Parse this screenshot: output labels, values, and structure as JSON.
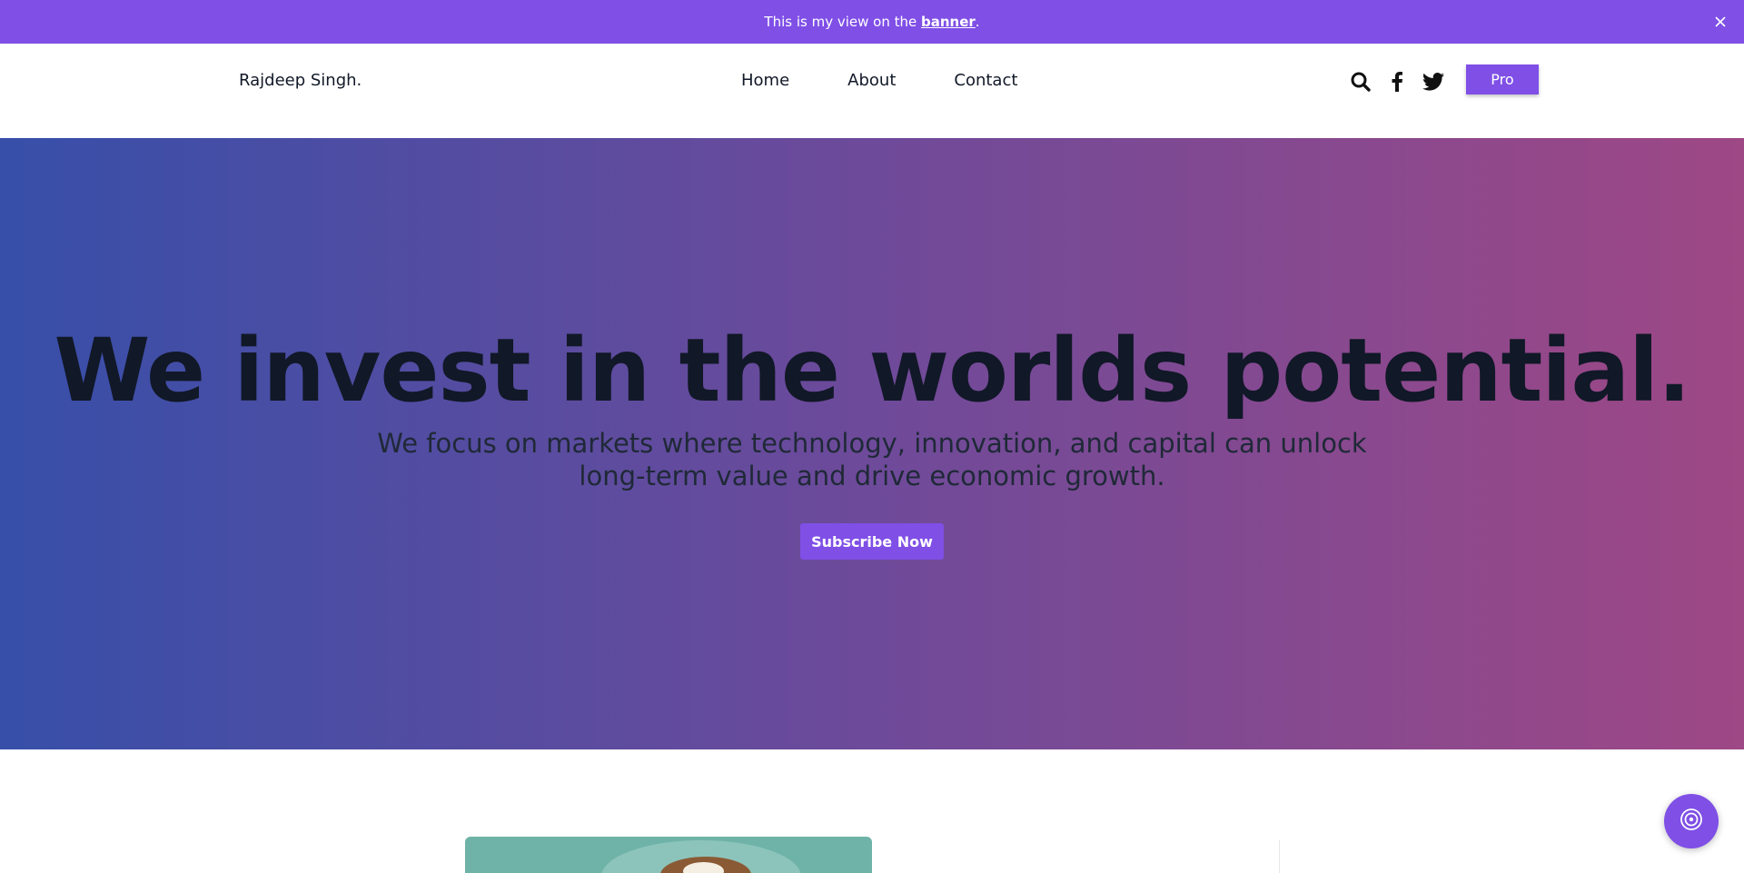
{
  "announcement": {
    "text_before": "This is my view on the ",
    "link_text": "banner",
    "text_after": ".",
    "close_icon": "close-icon"
  },
  "header": {
    "brand": "Rajdeep Singh.",
    "nav": {
      "home": "Home",
      "about": "About",
      "contact": "Contact"
    },
    "icons": [
      "search-icon",
      "facebook-icon",
      "twitter-icon"
    ],
    "pro_label": "Pro"
  },
  "hero": {
    "title": "We invest in the worlds potential.",
    "subtitle": "We focus on markets where technology, innovation, and capital can unlock long-term value and drive economic growth.",
    "cta_label": "Subscribe Now"
  },
  "fab": {
    "icon": "chat-support-icon"
  },
  "colors": {
    "accent": "#7f4fe6",
    "hero_gradient_start": "#374fa9",
    "hero_gradient_end": "#9e4885"
  }
}
